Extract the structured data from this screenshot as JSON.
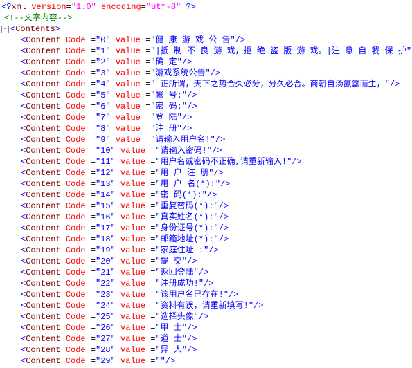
{
  "xml_declaration": {
    "version": "1.0",
    "encoding": "utf-8"
  },
  "comment": "文字内容",
  "root_tag": "Contents",
  "rows": [
    {
      "code": "0",
      "value": "健 康 游 戏 公 告"
    },
    {
      "code": "1",
      "value": "|抵 制 不 良 游 戏，拒 绝 盗 版 游 戏。|注 意 自 我 保 护"
    },
    {
      "code": "2",
      "value": "确  定"
    },
    {
      "code": "3",
      "value": "游戏系统公告"
    },
    {
      "code": "4",
      "value": "    正所谓，天下之势合久必分，分久必合。商朝自汤氤氲而生，"
    },
    {
      "code": "5",
      "value": "帐 号:"
    },
    {
      "code": "6",
      "value": "密 码:"
    },
    {
      "code": "7",
      "value": "登  陆"
    },
    {
      "code": "8",
      "value": "注  册"
    },
    {
      "code": "9",
      "value": "请输入用户名!"
    },
    {
      "code": "10",
      "value": "请输入密码!"
    },
    {
      "code": "11",
      "value": "用户名或密码不正确,请重新输入!"
    },
    {
      "code": "12",
      "value": "用 户 注 册"
    },
    {
      "code": "13",
      "value": "用 户 名(*):"
    },
    {
      "code": "14",
      "value": "密   码(*):"
    },
    {
      "code": "15",
      "value": "重复密码(*):"
    },
    {
      "code": "16",
      "value": "真实姓名(*):"
    },
    {
      "code": "17",
      "value": "身份证号(*):"
    },
    {
      "code": "18",
      "value": "邮箱地址(*):"
    },
    {
      "code": "19",
      "value": "家庭住址   :"
    },
    {
      "code": "20",
      "value": "提  交"
    },
    {
      "code": "21",
      "value": "返回登陆"
    },
    {
      "code": "22",
      "value": "注册成功!"
    },
    {
      "code": "23",
      "value": "该用户名已存在!"
    },
    {
      "code": "24",
      "value": "资料有误，请重新填写!"
    },
    {
      "code": "25",
      "value": "选择头像"
    },
    {
      "code": "26",
      "value": "甲  士"
    },
    {
      "code": "27",
      "value": "道  士"
    },
    {
      "code": "28",
      "value": "异  人"
    },
    {
      "code": "29",
      "value": ""
    }
  ]
}
